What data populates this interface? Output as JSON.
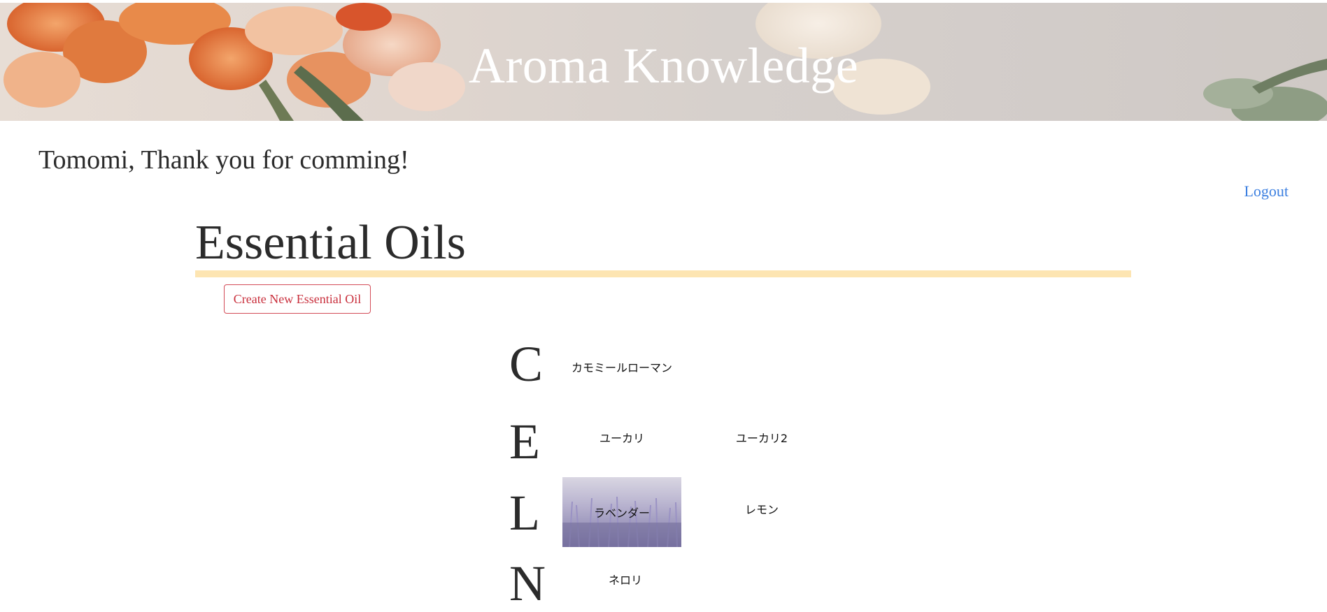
{
  "header": {
    "title": "Aroma Knowledge"
  },
  "welcome": {
    "message": "Tomomi, Thank you for comming!"
  },
  "nav": {
    "logout_label": "Logout"
  },
  "main": {
    "title": "Essential Oils",
    "create_button_label": "Create New Essential Oil",
    "groups": [
      {
        "letter": "C",
        "oils": [
          {
            "name": "カモミールローマン",
            "has_image": false
          }
        ]
      },
      {
        "letter": "E",
        "oils": [
          {
            "name": "ユーカリ",
            "has_image": false
          },
          {
            "name": "ユーカリ2",
            "has_image": false
          }
        ]
      },
      {
        "letter": "L",
        "oils": [
          {
            "name": "ラベンダー",
            "has_image": true
          },
          {
            "name": "レモン",
            "has_image": false
          }
        ]
      },
      {
        "letter": "N",
        "oils": [
          {
            "name": "ネロリ",
            "has_image": false
          }
        ]
      }
    ]
  },
  "colors": {
    "accent_link": "#3b7fe0",
    "section_rule": "#fde5b2",
    "create_button": "#c9303d"
  }
}
